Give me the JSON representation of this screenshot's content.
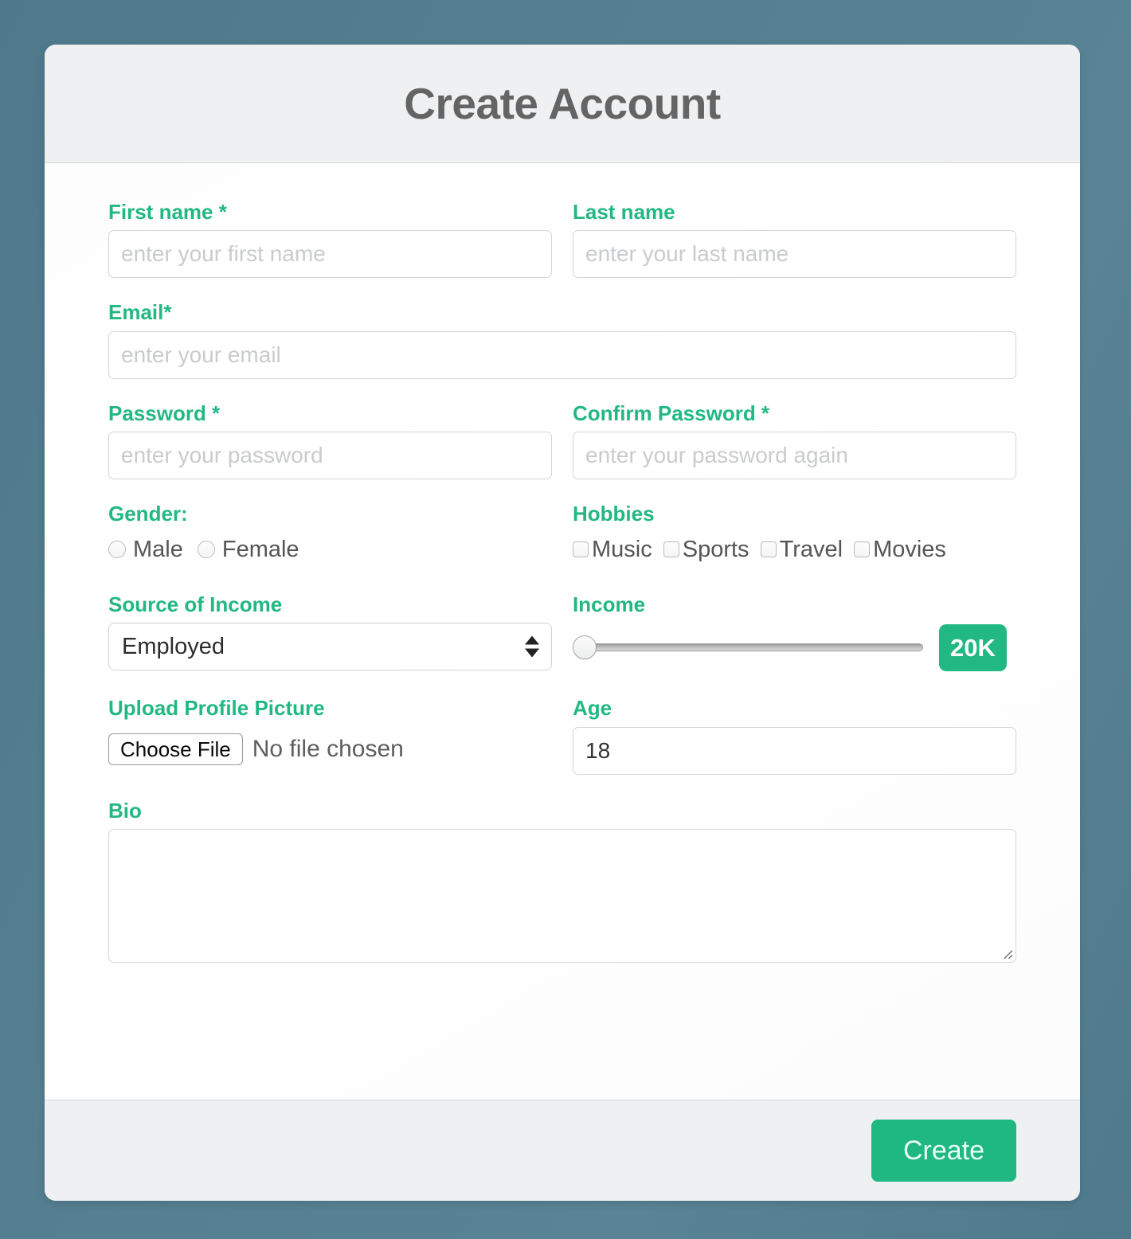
{
  "theme": {
    "accent": "#22b882",
    "page_background": "#547f90",
    "header_background": "#eff0f2",
    "title_color": "#646464"
  },
  "header": {
    "title": "Create Account"
  },
  "form": {
    "first_name": {
      "label": "First name *",
      "placeholder": "enter your first name",
      "value": ""
    },
    "last_name": {
      "label": "Last name",
      "placeholder": "enter your last name",
      "value": ""
    },
    "email": {
      "label": "Email*",
      "placeholder": "enter your email",
      "value": ""
    },
    "password": {
      "label": "Password *",
      "placeholder": "enter your password",
      "value": ""
    },
    "confirm_password": {
      "label": "Confirm Password *",
      "placeholder": "enter your password again",
      "value": ""
    },
    "gender": {
      "label": "Gender:",
      "options": [
        {
          "label": "Male",
          "checked": false
        },
        {
          "label": "Female",
          "checked": false
        }
      ]
    },
    "hobbies": {
      "label": "Hobbies",
      "options": [
        {
          "label": "Music",
          "checked": false
        },
        {
          "label": "Sports",
          "checked": false
        },
        {
          "label": "Travel",
          "checked": false
        },
        {
          "label": "Movies",
          "checked": false
        }
      ]
    },
    "source_of_income": {
      "label": "Source of Income",
      "selected": "Employed",
      "options": [
        "Employed"
      ]
    },
    "income": {
      "label": "Income",
      "value": "20K",
      "slider_position_percent": 0
    },
    "upload_profile_picture": {
      "label": "Upload Profile Picture",
      "button_label": "Choose File",
      "file_status": "No file chosen"
    },
    "age": {
      "label": "Age",
      "value": "18"
    },
    "bio": {
      "label": "Bio",
      "value": "",
      "placeholder": ""
    }
  },
  "footer": {
    "submit_label": "Create"
  }
}
